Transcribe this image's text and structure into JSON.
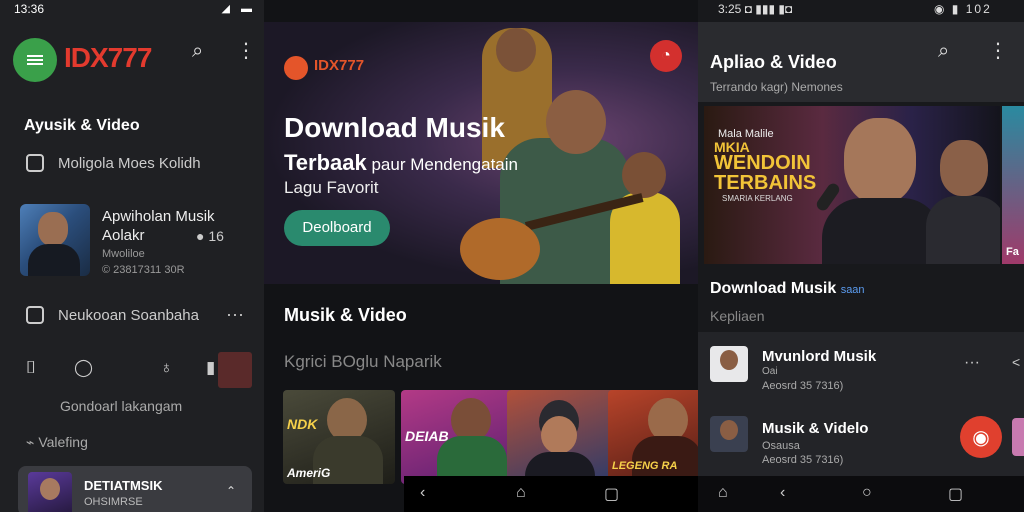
{
  "panel1": {
    "time": "13:36",
    "status_icons": "◢ ▬",
    "brand": "IDX777",
    "section_title": "Ayusik & Video",
    "menu_a": "Moligola Moes Kolidh",
    "song": {
      "title": "Apwiholan Musik Aolakr",
      "badge": "● 16",
      "meta1": "Mwoliloe",
      "meta2": "© 23817311 30R"
    },
    "menu_b": "Neukooan Soanbaha",
    "hint": "Gondoarl lakangam",
    "vale": "⌁ Valefing",
    "now_playing": {
      "title": "DETIATMSIK",
      "sub": "OHSIMRSE"
    }
  },
  "panel2": {
    "hero": {
      "logo": "IDX777",
      "title1": "Download Musik",
      "title2_bold": "Terbaak",
      "title2_rest": " paur Mendengatain",
      "title3": "Lagu Favorit",
      "cta": "Deolboard"
    },
    "section": "Musik & Video",
    "subsection": "Kgrici BOglu Naparik",
    "tiles": [
      {
        "caption": "NDK",
        "footer": "AmeriG"
      },
      {
        "caption": "DEIAB",
        "footer": ""
      },
      {
        "caption": "",
        "footer": ""
      },
      {
        "caption": "",
        "footer": "LEGENG RA"
      }
    ]
  },
  "panel3": {
    "time": "3:25 ◘ ▮▮▮ ▮◘",
    "status_right": "◉ ▮ 102",
    "title": "Apliao & Video",
    "subtitle": "Terrando kagr) Nemones",
    "banner": {
      "small": "Mala Malile",
      "big_line1": "MKIA",
      "big_line2": "WENDOIN",
      "big_line3": "TERBAINS",
      "tag": "SMARIA KERLANG",
      "side_text": "Fa"
    },
    "download": "Download Musik",
    "download_link": "saan",
    "download_sub": "Kepliaen",
    "list": [
      {
        "title": "Mvunlord Musik",
        "m1": "Oai",
        "m2": "Aeosrd 35 7316)"
      },
      {
        "title": "Musik & Videlo",
        "m1": "Osausa",
        "m2": "Aeosrd 35 7316)"
      }
    ]
  }
}
